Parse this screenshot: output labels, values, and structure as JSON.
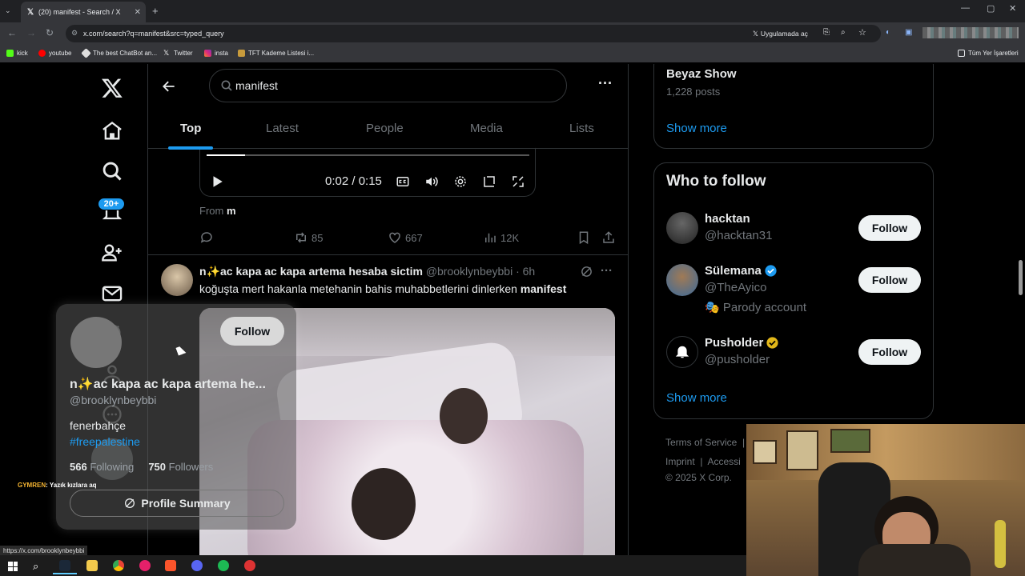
{
  "browser": {
    "tab_title": "(20) manifest - Search / X",
    "url": "x.com/search?q=manifest&src=typed_query",
    "open_in_app": "Uygulamada aç",
    "bookmarks": [
      "kick",
      "youtube",
      "The best ChatBot an...",
      "Twitter",
      "insta",
      "TFT Kademe Listesi i..."
    ],
    "all_bookmarks": "Tüm Yer İşaretleri",
    "status_url": "https://x.com/brooklynbeybbi"
  },
  "sidebar": {
    "notifications_badge": "20+"
  },
  "search": {
    "query": "manifest",
    "tabs": [
      "Top",
      "Latest",
      "People",
      "Media",
      "Lists"
    ],
    "active_tab": "Top"
  },
  "prev_tweet": {
    "video_time": "0:02 / 0:15",
    "video_progress": 0.12,
    "from_label": "From",
    "from_user": "m",
    "retweets": "85",
    "likes": "667",
    "views": "12K"
  },
  "tweet": {
    "name": "n✨ac kapa ac kapa artema hesaba sictim",
    "handle": "@brooklynbeybbi",
    "time": "· 6h",
    "text": "koğuşta mert hakanla metehanin bahis muhabbetlerini dinlerken",
    "text_bold": "manifest"
  },
  "hovercard": {
    "follow": "Follow",
    "name": "n✨ac kapa ac kapa artema he...",
    "handle": "@brooklynbeybbi",
    "bio": "fenerbahçe",
    "hashtag": "#freepalestine",
    "following_count": "566",
    "following_label": "Following",
    "followers_count": "750",
    "followers_label": "Followers",
    "summary": "Profile Summary"
  },
  "trends": {
    "name": "Beyaz Show",
    "posts": "1,228 posts",
    "show_more": "Show more"
  },
  "who_to_follow": {
    "title": "Who to follow",
    "users": [
      {
        "name": "hacktan",
        "handle": "@hacktan31",
        "extra": "",
        "verified": false,
        "button": "Follow"
      },
      {
        "name": "Sülemana",
        "handle": "@TheAyico",
        "extra": "🎭 Parody account",
        "verified": true,
        "badge_color": "#1d9bf0",
        "button": "Follow"
      },
      {
        "name": "Pusholder",
        "handle": "@pusholder",
        "extra": "",
        "verified": true,
        "badge_color": "#e2b719",
        "button": "Follow"
      }
    ],
    "show_more": "Show more"
  },
  "footer": {
    "terms": "Terms of Service",
    "imprint": "Imprint",
    "sep": "|",
    "access": "Accessi",
    "copyright": "© 2025 X Corp."
  },
  "stream_chat": {
    "user": "GYMREN",
    "message": ": Yazık kızlara aq"
  },
  "colors": {
    "accent": "#1d9bf0",
    "background": "#000000",
    "border": "#2f3336",
    "muted": "#71767b"
  }
}
